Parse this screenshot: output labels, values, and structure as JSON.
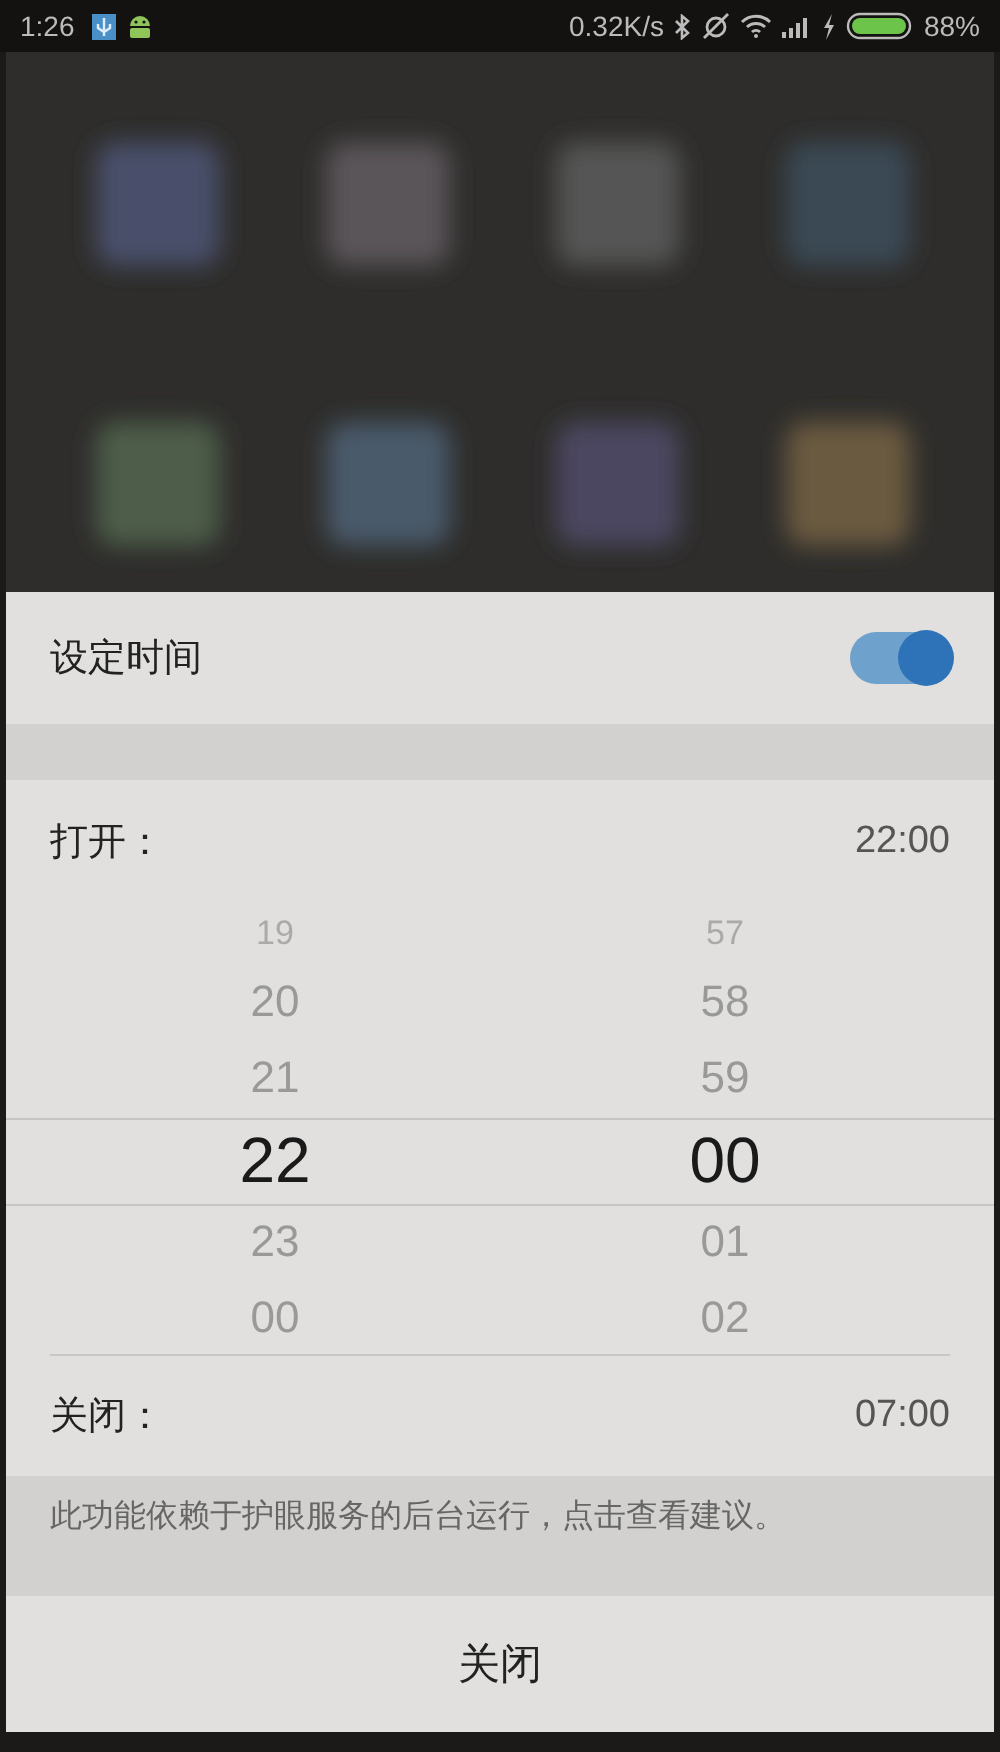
{
  "status_bar": {
    "time": "1:26",
    "speed": "0.32K/s",
    "battery": "88%"
  },
  "sheet": {
    "schedule": {
      "label": "设定时间",
      "on": true
    },
    "start": {
      "label": "打开：",
      "value": "22:00"
    },
    "picker": {
      "hours": [
        {
          "text": "19",
          "selected": false
        },
        {
          "text": "20",
          "selected": false
        },
        {
          "text": "21",
          "selected": false
        },
        {
          "text": "22",
          "selected": true
        },
        {
          "text": "23",
          "selected": false
        },
        {
          "text": "00",
          "selected": false
        }
      ],
      "minutes": [
        {
          "text": "57",
          "selected": false
        },
        {
          "text": "58",
          "selected": false
        },
        {
          "text": "59",
          "selected": false
        },
        {
          "text": "00",
          "selected": true
        },
        {
          "text": "01",
          "selected": false
        },
        {
          "text": "02",
          "selected": false
        }
      ]
    },
    "end": {
      "label": "关闭：",
      "value": "07:00"
    },
    "note": "此功能依赖于护眼服务的后台运行，点击查看建议。",
    "button": "关闭"
  }
}
